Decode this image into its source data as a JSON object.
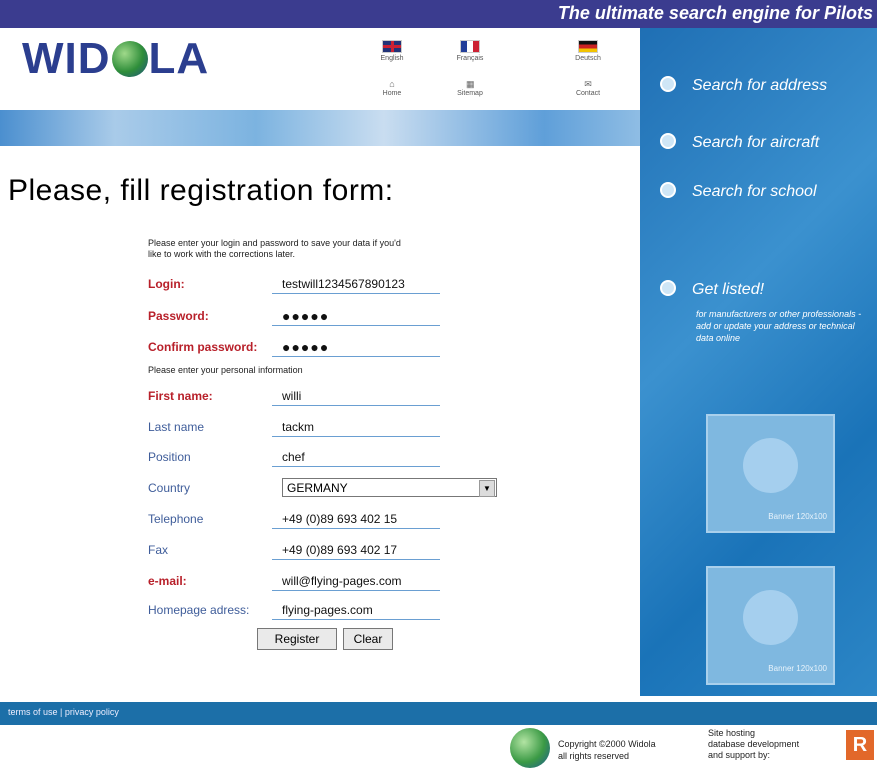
{
  "header": {
    "tagline": "The ultimate search engine for Pilots",
    "logo_text_left": "WID",
    "logo_text_right": "LA"
  },
  "languages": [
    {
      "label": "English",
      "flag_colors": [
        "#cc2233",
        "#ffffff",
        "#223377"
      ]
    },
    {
      "label": "Français",
      "flag_colors": [
        "#223e99",
        "#ffffff",
        "#cc2233"
      ]
    },
    {
      "label": "Deutsch",
      "flag_colors": [
        "#111111",
        "#cc2222",
        "#f2c300"
      ]
    }
  ],
  "utility_links": [
    "Home",
    "Sitemap",
    "Contact"
  ],
  "sidebar": {
    "items": [
      {
        "label": "Search for address"
      },
      {
        "label": "Search for aircraft"
      },
      {
        "label": "Search for school"
      },
      {
        "label": "Get listed!"
      }
    ],
    "get_listed_desc": "for manufacturers or other professionals - add or update your address or technical data online",
    "ad_text": "Banner 120x100"
  },
  "page_title": "Please, fill registration form:",
  "intro": "Please enter your login and password to save your data if you'd like to work with the corrections later.",
  "form": {
    "login": {
      "label": "Login:",
      "value": "testwill1234567890123"
    },
    "password": {
      "label": "Password:",
      "value": "●●●●●"
    },
    "confirm_password": {
      "label": "Confirm password:",
      "value": "●●●●●"
    },
    "password_hint": "Please enter your personal information",
    "first_name": {
      "label": "First name:",
      "value": "willi"
    },
    "last_name": {
      "label": "Last name",
      "value": "tackm"
    },
    "position": {
      "label": "Position",
      "value": "chef"
    },
    "country": {
      "label": "Country",
      "value": "GERMANY"
    },
    "telephone": {
      "label": "Telephone",
      "value": "+49 (0)89 693 402 15"
    },
    "fax": {
      "label": "Fax",
      "value": "+49 (0)89 693 402 17"
    },
    "email": {
      "label": "e-mail:",
      "value": "will@flying-pages.com"
    },
    "homepage": {
      "label": "Homepage adress:",
      "value": "flying-pages.com"
    },
    "register_label": "Register",
    "clear_label": "Clear"
  },
  "footer": {
    "link": "terms of use | privacy policy",
    "copyright_line1": "Copyright ©2000 Widola",
    "copyright_line2": "all rights reserved",
    "dev_line1": "Site hosting",
    "dev_line2": "database development",
    "dev_line3": "and support by:"
  },
  "colors": {
    "banner": "#3b3c8f",
    "required_label": "#b8202a",
    "optional_label": "#3f5d9a",
    "panel": "#1f6fb4"
  }
}
